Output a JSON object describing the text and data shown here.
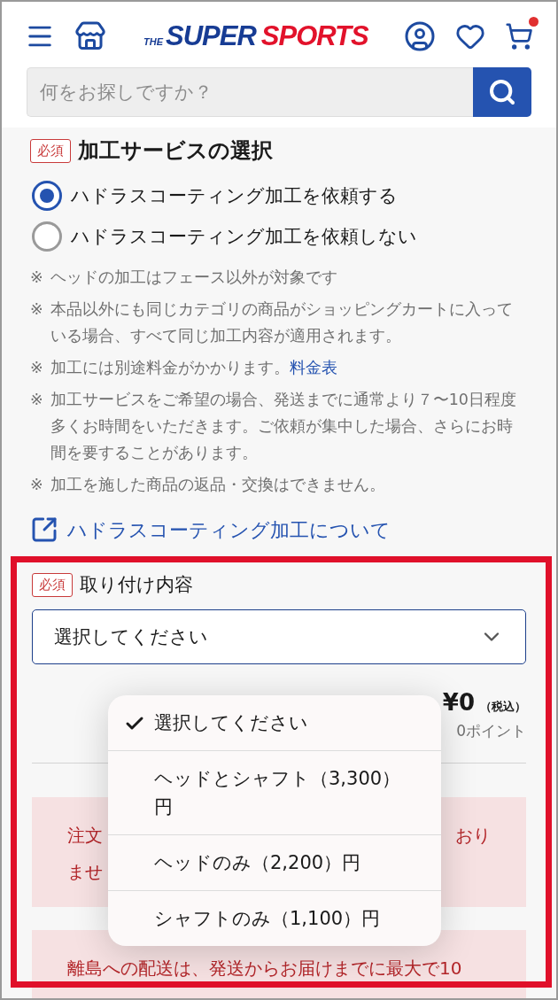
{
  "header": {
    "logo": {
      "small": "THE",
      "first": "SUPER",
      "second": "SPORTS"
    },
    "cart_badge": true
  },
  "search": {
    "placeholder": "何をお探しですか？"
  },
  "service_section": {
    "badge": "必須",
    "title": "加工サービスの選択",
    "radios": [
      {
        "label": "ハドラスコーティング加工を依頼する",
        "selected": true
      },
      {
        "label": "ハドラスコーティング加工を依頼しない",
        "selected": false
      }
    ],
    "notes": [
      {
        "mark": "※",
        "text": "ヘッドの加工はフェース以外が対象です"
      },
      {
        "mark": "※",
        "text": "本品以外にも同じカテゴリの商品がショッピングカートに入っている場合、すべて同じ加工内容が適用されます。"
      },
      {
        "mark": "※",
        "text": "加工には別途料金がかかります。",
        "link": "料金表"
      },
      {
        "mark": "※",
        "text": "加工サービスをご希望の場合、発送までに通常より７〜10日程度多くお時間をいただきます。ご依頼が集中した場合、さらにお時間を要することがあります。"
      },
      {
        "mark": "※",
        "text": "加工を施した商品の返品・交換はできません。"
      }
    ],
    "about_link": "ハドラスコーティング加工について"
  },
  "install_section": {
    "badge": "必須",
    "title": "取り付け内容",
    "select_value": "選択してください",
    "price": "¥0",
    "tax": "（税込）",
    "points": "0ポイント",
    "alerts": [
      {
        "lines": [
          {
            "left": "注文",
            "right": "おり"
          },
          {
            "left": "ませ"
          }
        ]
      },
      {
        "lines": [
          {
            "left": "離島への配送は、発送からお届けまでに最大で10"
          }
        ]
      }
    ]
  },
  "dropdown": {
    "options": [
      {
        "label": "選択してください",
        "selected": true
      },
      {
        "label": "ヘッドとシャフト（3,300）円",
        "selected": false
      },
      {
        "label": "ヘッドのみ（2,200）円",
        "selected": false
      },
      {
        "label": "シャフトのみ（1,100）円",
        "selected": false
      }
    ]
  },
  "highlight_frame": true
}
